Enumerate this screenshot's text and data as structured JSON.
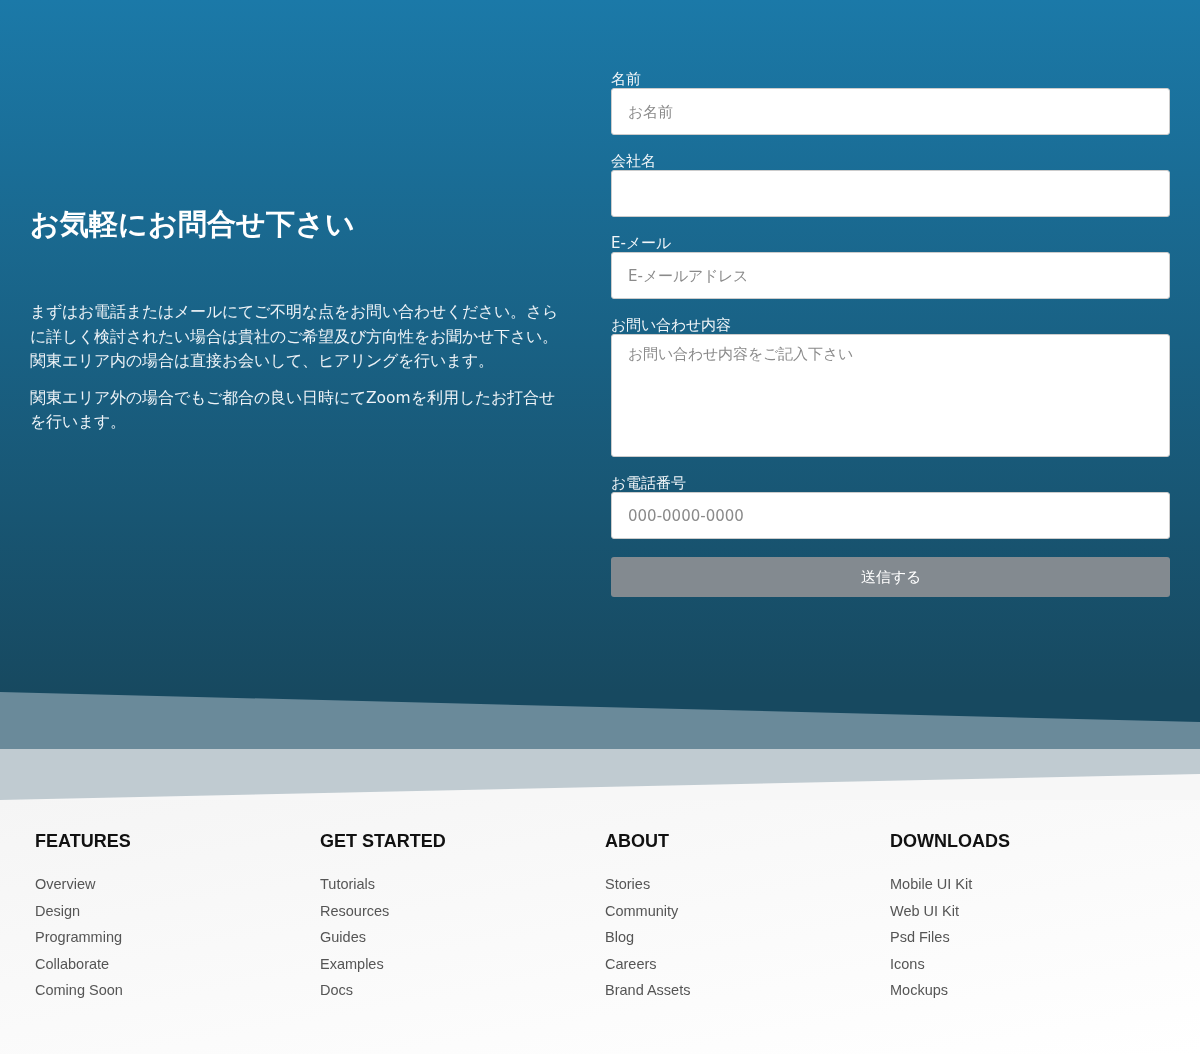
{
  "contact": {
    "heading": "お気軽にお問合せ下さい",
    "paragraphs": [
      "まずはお電話またはメールにてご不明な点をお問い合わせください。さらに詳しく検討されたい場合は貴社のご希望及び方向性をお聞かせ下さい。関東エリア内の場合は直接お会いして、ヒアリングを行います。",
      "関東エリア外の場合でもご都合の良い日時にてZoomを利用したお打合せを行います。"
    ],
    "fields": [
      {
        "label": "名前",
        "kind": "input",
        "placeholder": "お名前"
      },
      {
        "label": "会社名",
        "kind": "input"
      },
      {
        "label": "E-メール",
        "kind": "input",
        "placeholder": "E-メールアドレス"
      },
      {
        "label": "お問い合わせ内容",
        "kind": "textarea",
        "placeholder": "お問い合わせ内容をご記入下さい"
      },
      {
        "label": "お電話番号",
        "kind": "input",
        "placeholder": "000-0000-0000"
      }
    ],
    "submit": "送信する"
  },
  "footer": {
    "columns": [
      {
        "heading": "FEATURES",
        "links": [
          "Overview",
          "Design",
          "Programming",
          "Collaborate",
          "Coming Soon"
        ]
      },
      {
        "heading": "GET STARTED",
        "links": [
          "Tutorials",
          "Resources",
          "Guides",
          "Examples",
          "Docs"
        ]
      },
      {
        "heading": "ABOUT",
        "links": [
          "Stories",
          "Community",
          "Blog",
          "Careers",
          "Brand Assets"
        ]
      },
      {
        "heading": "DOWNLOADS",
        "links": [
          "Mobile UI Kit",
          "Web UI Kit",
          "Psd Files",
          "Icons",
          "Mockups"
        ]
      }
    ]
  }
}
